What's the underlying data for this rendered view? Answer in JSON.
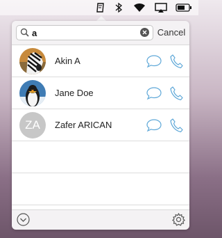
{
  "menubar": {
    "icons": [
      "phone-app-icon",
      "bluetooth-icon",
      "wifi-icon",
      "airplay-icon",
      "battery-icon"
    ]
  },
  "search": {
    "value": "a",
    "icon": "search-icon",
    "clear_icon": "clear-icon"
  },
  "cancel_label": "Cancel",
  "contacts": [
    {
      "name": "Akin A",
      "avatar": "zebra-photo"
    },
    {
      "name": "Jane Doe",
      "avatar": "penguin-photo"
    },
    {
      "name": "Zafer ARICAN",
      "avatar_initials": "ZA"
    }
  ],
  "footer": {
    "left_icon": "chevron-down-circle-icon",
    "right_icon": "gear-icon"
  },
  "colors": {
    "accent": "#5fa8d8",
    "list_background": "#ffffff",
    "popover_background": "#f4f2f4"
  }
}
